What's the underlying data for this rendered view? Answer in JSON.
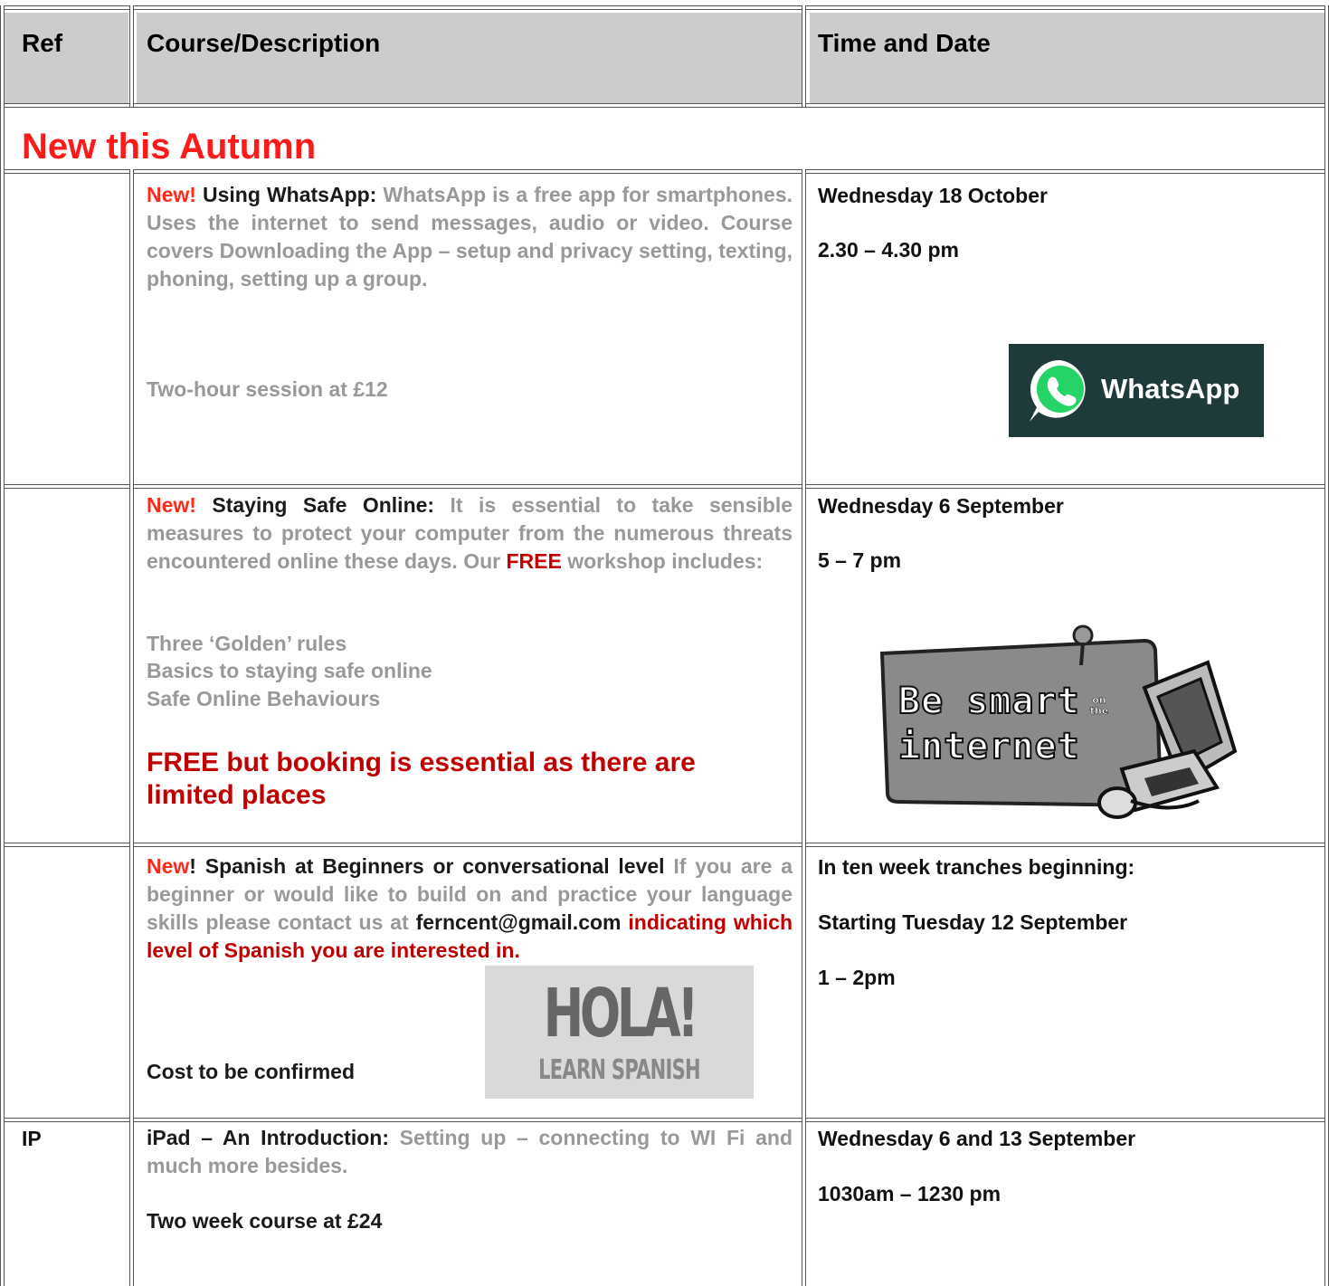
{
  "header": {
    "ref": "Ref",
    "course": "Course/Description",
    "time": "Time and Date"
  },
  "section_title": "New this Autumn",
  "rows": [
    {
      "ref": "",
      "new": "New!",
      "title": "Using WhatsApp:",
      "desc": "WhatsApp is a free app for smartphones.  Uses the internet to send messages, audio or video.  Course covers Downloading the App – setup and privacy setting, texting, phoning, setting up a group.",
      "price": "Two-hour session at £12",
      "date1": "Wednesday 18 October",
      "date2": "2.30 – 4.30 pm",
      "logo_text": "WhatsApp"
    },
    {
      "ref": "",
      "new": "New!",
      "title": "Staying Safe Online:",
      "desc_a": "It is essential to take sensible measures to protect your computer from the numerous threats encountered online these days. Our",
      "free": "FREE",
      "desc_b": "workshop includes:",
      "bullets": [
        "Three ‘Golden’ rules",
        "Basics to staying safe online",
        "Safe Online Behaviours"
      ],
      "notice_l1": "FREE but booking is essential as there are",
      "notice_l2": "limited places",
      "date1": "Wednesday 6 September",
      "date2": "5 – 7 pm",
      "logo_line1": "Be smart",
      "logo_small": "on the",
      "logo_line2": "internet"
    },
    {
      "ref": "",
      "new": "New",
      "title": "! Spanish at Beginners or conversational level",
      "desc": "If you are a beginner or would like to build on and practice your language skills please contact us at",
      "email": "ferncent@gmail.com",
      "desc_b": "indicating which level of Spanish you are interested in.",
      "price": "Cost to be confirmed",
      "date1": "In ten week tranches beginning:",
      "date2": "Starting Tuesday 12 September",
      "date3": "1 – 2pm",
      "logo_big": "HOLA!",
      "logo_small": "LEARN SPANISH"
    },
    {
      "ref": "IP",
      "title": "iPad – An Introduction:",
      "desc": "Setting up – connecting to WI Fi and much more besides.",
      "price": "Two week course at £24",
      "date1": "Wednesday 6 and 13 September",
      "date2": "1030am – 1230 pm"
    }
  ],
  "colors": {
    "header_bg": "#cccccc",
    "red": "#ff1a1a",
    "crimson": "#c00000",
    "whatsapp_bg": "#1f3a3a",
    "whatsapp_green": "#25d366"
  }
}
